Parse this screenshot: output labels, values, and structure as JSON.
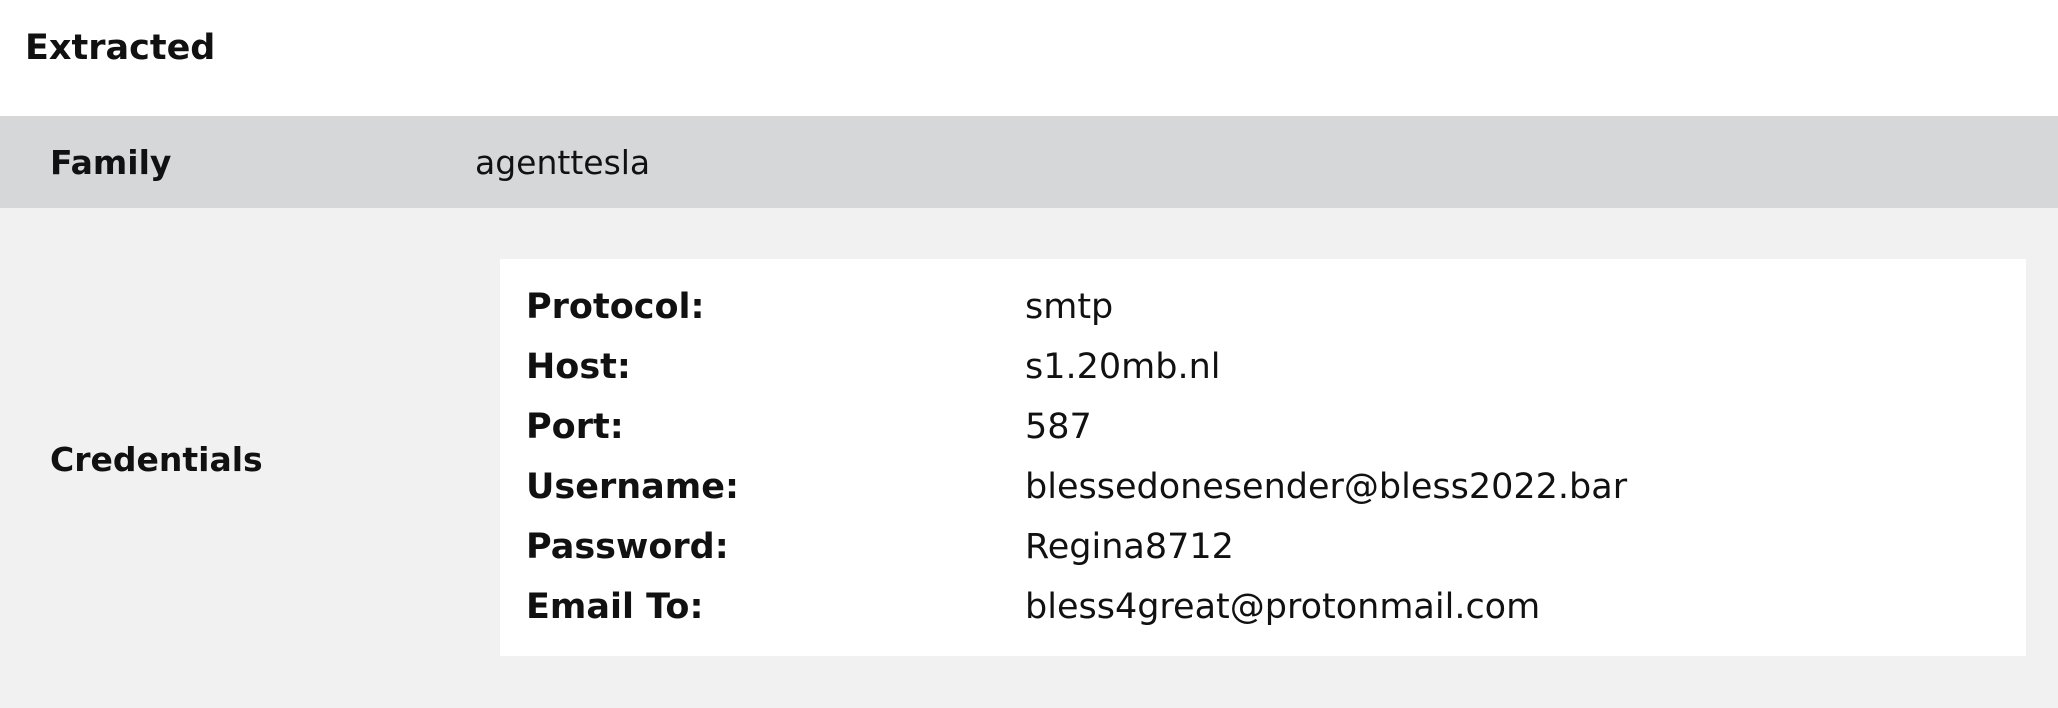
{
  "extracted": {
    "title": "Extracted"
  },
  "family": {
    "label": "Family",
    "value": "agenttesla"
  },
  "credentials": {
    "label": "Credentials",
    "fields": [
      {
        "key": "Protocol:",
        "value": "smtp"
      },
      {
        "key": "Host:",
        "value": "s1.20mb.nl"
      },
      {
        "key": "Port:",
        "value": "587"
      },
      {
        "key": "Username:",
        "value": "blessedonesender@bless2022.bar"
      },
      {
        "key": "Password:",
        "value": "Regina8712"
      },
      {
        "key": "Email To:",
        "value": "bless4great@protonmail.com"
      }
    ]
  }
}
